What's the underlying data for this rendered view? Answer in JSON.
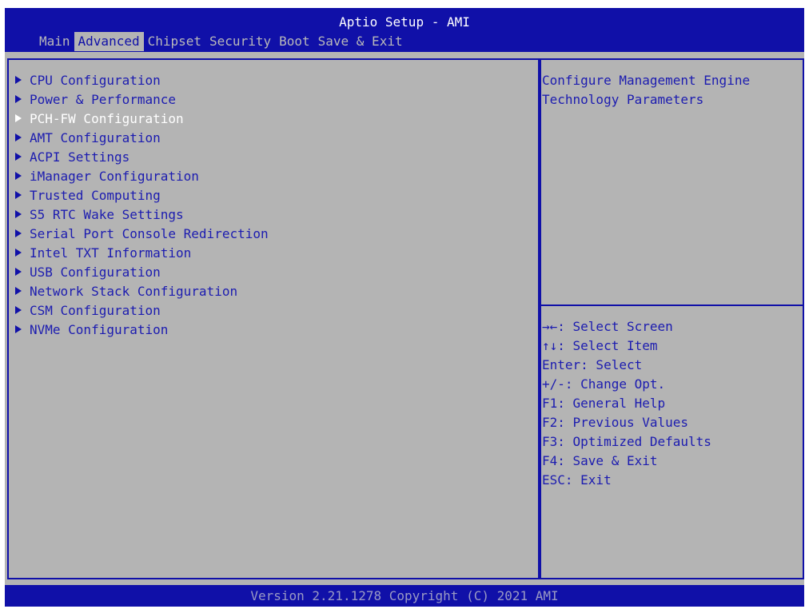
{
  "header": {
    "title": "Aptio Setup - AMI",
    "tabs": [
      {
        "label": "Main",
        "active": false
      },
      {
        "label": "Advanced",
        "active": true
      },
      {
        "label": "Chipset",
        "active": false
      },
      {
        "label": "Security",
        "active": false
      },
      {
        "label": "Boot",
        "active": false
      },
      {
        "label": "Save & Exit",
        "active": false
      }
    ]
  },
  "menu": {
    "selected_index": 2,
    "items": [
      "CPU Configuration",
      "Power & Performance",
      "PCH-FW Configuration",
      "AMT Configuration",
      "ACPI Settings",
      "iManager Configuration",
      "Trusted Computing",
      "S5 RTC Wake Settings",
      "Serial Port Console Redirection",
      "Intel TXT Information",
      "USB Configuration",
      "Network Stack Configuration",
      "CSM Configuration",
      "NVMe Configuration"
    ]
  },
  "help": {
    "lines": [
      "Configure Management Engine",
      "Technology Parameters"
    ]
  },
  "keys": [
    "→←: Select Screen",
    "↑↓: Select Item",
    "Enter: Select",
    "+/-: Change Opt.",
    "F1: General Help",
    "F2: Previous Values",
    "F3: Optimized Defaults",
    "F4: Save & Exit",
    "ESC: Exit"
  ],
  "footer": {
    "text": "Version 2.21.1278 Copyright (C) 2021 AMI"
  },
  "colors": {
    "background_gray": "#b4b4b4",
    "bios_blue": "#1010a8",
    "highlight_white": "#ffffff"
  }
}
